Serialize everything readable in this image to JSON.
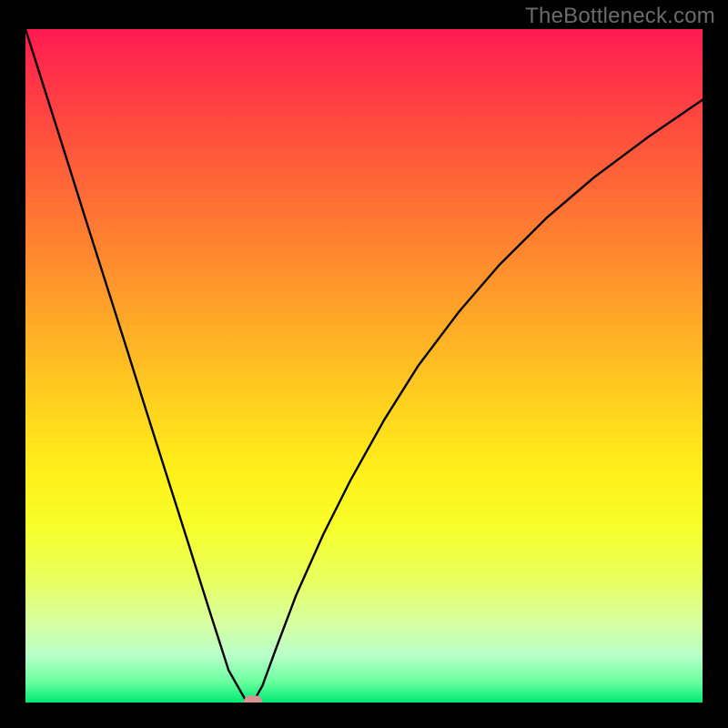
{
  "watermark": "TheBottleneck.com",
  "chart_data": {
    "type": "line",
    "title": "",
    "xlabel": "",
    "ylabel": "",
    "xlim": [
      0,
      100
    ],
    "ylim": [
      0,
      100
    ],
    "background": "vertical-gradient red→orange→yellow→green",
    "series": [
      {
        "name": "bottleneck-curve",
        "x": [
          0,
          3,
          6,
          9,
          12,
          15,
          18,
          21,
          24,
          27,
          30,
          32.6,
          33.6,
          35,
          37,
          40,
          44,
          48,
          53,
          58,
          64,
          70,
          77,
          84,
          92,
          100
        ],
        "y": [
          100,
          90.5,
          81,
          71.4,
          61.9,
          52.4,
          42.8,
          33.3,
          23.8,
          14.2,
          4.8,
          0.2,
          0,
          2.5,
          8,
          16,
          25,
          33,
          42,
          50,
          58,
          65,
          72,
          78,
          84,
          89.5
        ]
      }
    ],
    "markers": [
      {
        "name": "optimal-point",
        "x": 33.6,
        "y": 0.2,
        "color": "#d99393"
      }
    ],
    "notes": "V-shaped curve with minimum (optimal point) at roughly x=33.6. Left branch descends linearly from top-left corner; right branch rises with diminishing slope toward upper-right."
  }
}
